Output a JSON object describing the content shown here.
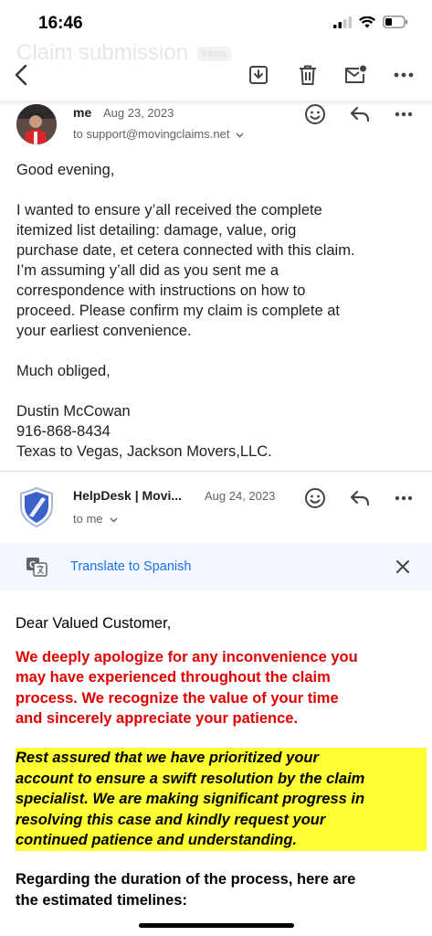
{
  "status_bar": {
    "time": "16:46"
  },
  "email": {
    "subject": "Claim submission",
    "label": "Inbox"
  },
  "message1": {
    "sender": "me",
    "date": "Aug 23, 2023",
    "to": "to support@movingclaims.net",
    "body": {
      "greeting": "Good evening,",
      "paragraph_lines": [
        "I wanted to ensure y’all received the complete",
        "itemized list detailing: damage, value, orig",
        "purchase date, et cetera connected with this claim.",
        "I’m assuming y’all did as you sent me a",
        "correspondence with instructions on how to",
        "proceed. Please confirm my claim is complete at",
        "your earliest convenience."
      ],
      "closing": "Much obliged,",
      "signature_lines": [
        "Dustin McCowan",
        "916-868-8434",
        "Texas to Vegas, Jackson Movers,LLC."
      ]
    }
  },
  "message2": {
    "sender": "HelpDesk | Movi...",
    "date": "Aug 24, 2023",
    "to": "to me",
    "translate_label": "Translate to Spanish",
    "body": {
      "greeting": "Dear Valued Customer,",
      "red_lines": [
        "We deeply apologize for any inconvenience you",
        "may have experienced throughout the claim",
        "process. We recognize the value of your time",
        "and sincerely appreciate your patience."
      ],
      "highlight_lines": [
        "Rest assured that we have prioritized your",
        "account to ensure a swift resolution by the claim",
        "specialist. We are making significant progress in",
        "resolving this case and kindly request your",
        "continued patience and understanding."
      ],
      "duration_lines": [
        "Regarding the duration of the process, here are",
        "the estimated timelines:"
      ]
    }
  },
  "colors": {
    "link": "#1a73e8",
    "apology_text": "#e00000",
    "highlight": "#ffff33",
    "translate_bar": "#f3f6fc",
    "helpdesk_shield": "#3a62c9"
  },
  "icons": {
    "toolbar": [
      "back-arrow-icon",
      "archive-icon",
      "trash-icon",
      "mark-unread-icon",
      "more-icon"
    ],
    "message_actions": [
      "emoji-icon",
      "reply-icon",
      "more-icon"
    ],
    "translate": "translate-icon",
    "close": "close-icon"
  }
}
